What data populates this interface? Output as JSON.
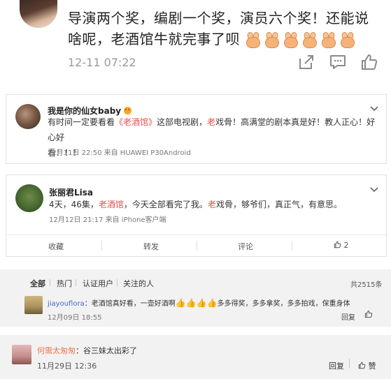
{
  "post": {
    "text": "导演两个奖，编剧一个奖，演员六个奖！还能说啥呢，老酒馆牛就完事了呗",
    "emoji": [
      "hands-icon",
      "hands-icon",
      "hands-icon",
      "hands-icon",
      "hands-icon",
      "hands-icon"
    ],
    "time": "12-11 07:22",
    "icons": [
      "share-icon",
      "comment-icon",
      "like-icon"
    ]
  },
  "comment1": {
    "username": "我是你的仙女baby",
    "text_a": "有时间一定要看看",
    "text_tag": "《老酒馆》",
    "text_b": "这部电视剧，",
    "text_hl": "老",
    "text_c": "戏骨！高满堂的剧本真是好！教人正心！好心好",
    "text_line2": "看！！！",
    "meta": "12月11日 22:50  来自 HUAWEI P30Android"
  },
  "comment2": {
    "username": "张丽君Lisa",
    "text_a": "4天，46集，",
    "text_tag": "老酒馆",
    "text_b": "，今天全部看完了我。",
    "text_hl": "老",
    "text_c": "戏骨，够爷们，真正气，有意思。",
    "meta": "12月12日 21:17  来自 iPhone客户端",
    "actions": {
      "collect": "收藏",
      "repost": "转发",
      "comment": "评论",
      "like_count": "2"
    }
  },
  "comments_panel": {
    "tabs": [
      "全部",
      "热门",
      "认证用户",
      "关注的人"
    ],
    "total": "共2515条",
    "reply": {
      "username": "jiayouflora",
      "text": "：老酒馆真好看，一壶好酒啊",
      "text_after": "多多得奖，多多拿奖，多多拍戏，保重身体",
      "time": "12月09日 18:55",
      "reply_label": "回复"
    }
  },
  "last_comment": {
    "username": "何需太匆匆",
    "text": "：谷三妹太出彩了",
    "time": "11月29日 12:36",
    "reply_label": "回复",
    "like_label": "赞"
  },
  "colors": {
    "accent_red": "#eb4c4c",
    "link_orange": "#eb7350",
    "username_blue": "#3b6cc6"
  }
}
